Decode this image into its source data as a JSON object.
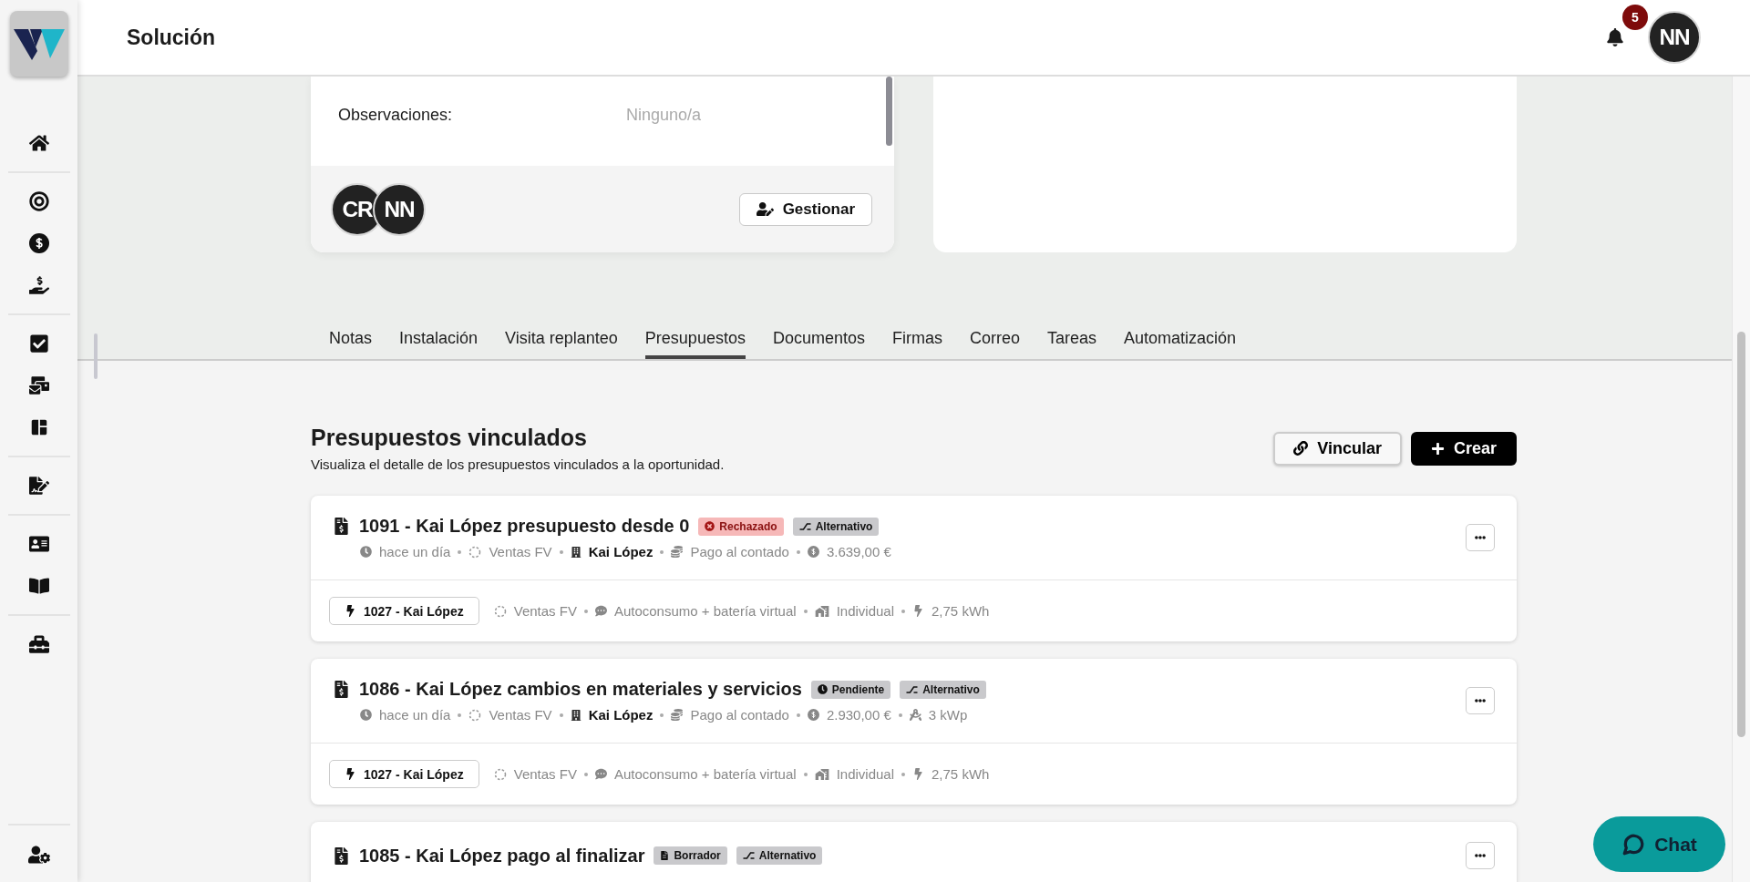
{
  "header": {
    "title": "Solución",
    "notifications": "5",
    "user_initials": "NN"
  },
  "info_card": {
    "fields": [
      {
        "label": "Observaciones:",
        "value": "Ninguno/a"
      }
    ],
    "members": [
      "CR",
      "NN"
    ],
    "manage_button": "Gestionar"
  },
  "tabs": [
    {
      "label": "Notas",
      "selected": false
    },
    {
      "label": "Instalación",
      "selected": false
    },
    {
      "label": "Visita replanteo",
      "selected": false
    },
    {
      "label": "Presupuestos",
      "selected": true
    },
    {
      "label": "Documentos",
      "selected": false
    },
    {
      "label": "Firmas",
      "selected": false
    },
    {
      "label": "Correo",
      "selected": false
    },
    {
      "label": "Tareas",
      "selected": false
    },
    {
      "label": "Automatización",
      "selected": false
    }
  ],
  "section": {
    "title": "Presupuestos vinculados",
    "subtitle": "Visualiza el detalle de los presupuestos vinculados a la oportunidad.",
    "link_button": "Vincular",
    "create_button": "Crear"
  },
  "budgets": [
    {
      "title": "1091 - Kai López presupuesto desde 0",
      "status": {
        "kind": "rejected",
        "label": "Rechazado"
      },
      "type_tag": "Alternativo",
      "meta": [
        {
          "kind": "time",
          "text": "hace un día"
        },
        {
          "kind": "pipeline",
          "text": "Ventas FV"
        },
        {
          "kind": "client",
          "text": "Kai López"
        },
        {
          "kind": "payment",
          "text": "Pago al contado"
        },
        {
          "kind": "amount",
          "text": "3.639,00 €"
        }
      ],
      "opportunity": "1027 - Kai López",
      "details": [
        {
          "kind": "pipeline",
          "text": "Ventas FV"
        },
        {
          "kind": "mode",
          "text": "Autoconsumo + batería virtual"
        },
        {
          "kind": "building",
          "text": "Individual"
        },
        {
          "kind": "energy",
          "text": "2,75 kWh"
        }
      ]
    },
    {
      "title": "1086 - Kai López cambios en materiales y servicios",
      "status": {
        "kind": "pending",
        "label": "Pendiente"
      },
      "type_tag": "Alternativo",
      "meta": [
        {
          "kind": "time",
          "text": "hace un día"
        },
        {
          "kind": "pipeline",
          "text": "Ventas FV"
        },
        {
          "kind": "client",
          "text": "Kai López"
        },
        {
          "kind": "payment",
          "text": "Pago al contado"
        },
        {
          "kind": "amount",
          "text": "2.930,00 €"
        },
        {
          "kind": "power",
          "text": "3 kWp"
        }
      ],
      "opportunity": "1027 - Kai López",
      "details": [
        {
          "kind": "pipeline",
          "text": "Ventas FV"
        },
        {
          "kind": "mode",
          "text": "Autoconsumo + batería virtual"
        },
        {
          "kind": "building",
          "text": "Individual"
        },
        {
          "kind": "energy",
          "text": "2,75 kWh"
        }
      ]
    },
    {
      "title": "1085 - Kai López pago al finalizar",
      "status": {
        "kind": "draft",
        "label": "Borrador"
      },
      "type_tag": "Alternativo"
    }
  ],
  "chat_button": "Chat"
}
